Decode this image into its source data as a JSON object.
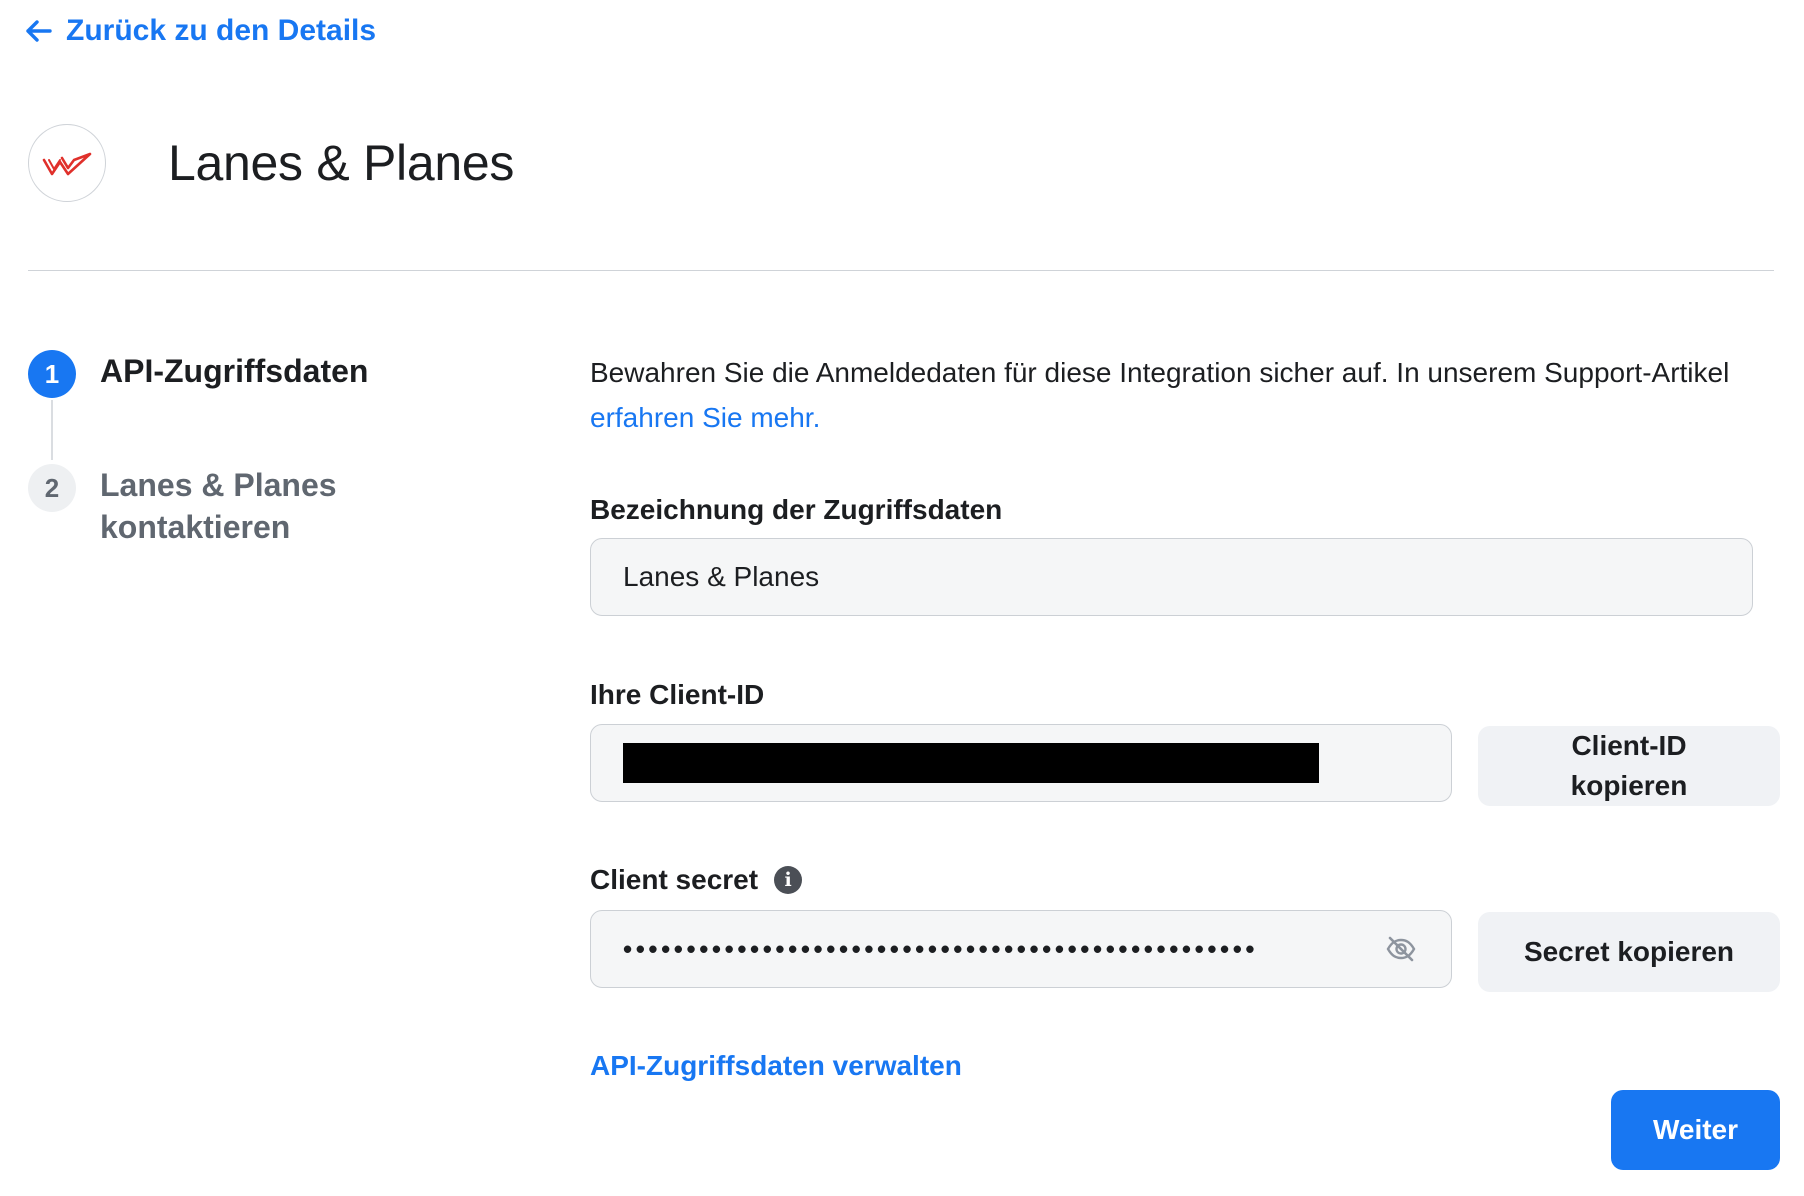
{
  "nav": {
    "back_label": "Zurück zu den Details",
    "back_icon": "arrow-left-icon"
  },
  "header": {
    "app_name": "Lanes & Planes",
    "logo_icon": "plane-logo-icon"
  },
  "stepper": {
    "steps": [
      {
        "number": "1",
        "label": "API-Zugriffsdaten",
        "state": "active"
      },
      {
        "number": "2",
        "label": "Lanes & Planes kontaktieren",
        "state": "inactive"
      }
    ]
  },
  "form": {
    "intro_text": "Bewahren Sie die Anmeldedaten für diese Integration sicher auf. In unserem Support-Artikel ",
    "intro_link": "erfahren Sie mehr.",
    "credential_name": {
      "label": "Bezeichnung der Zugriffsdaten",
      "value": "Lanes & Planes"
    },
    "client_id": {
      "label": "Ihre Client-ID",
      "copy_button": "Client-ID kopieren"
    },
    "client_secret": {
      "label": "Client secret",
      "masked_value": "••••••••••••••••••••••••••••••••••••••••••••••••••",
      "copy_button": "Secret kopieren",
      "info_icon": "info-icon",
      "visibility_icon": "eye-slash-icon"
    },
    "manage_link": "API-Zugriffsdaten verwalten",
    "next_button": "Weiter"
  },
  "colors": {
    "accent": "#1877f2",
    "text": "#1c1e21",
    "muted": "#606770",
    "field_bg": "#f5f6f7",
    "button_bg": "#f0f2f5",
    "logo_red": "#e0302b"
  }
}
